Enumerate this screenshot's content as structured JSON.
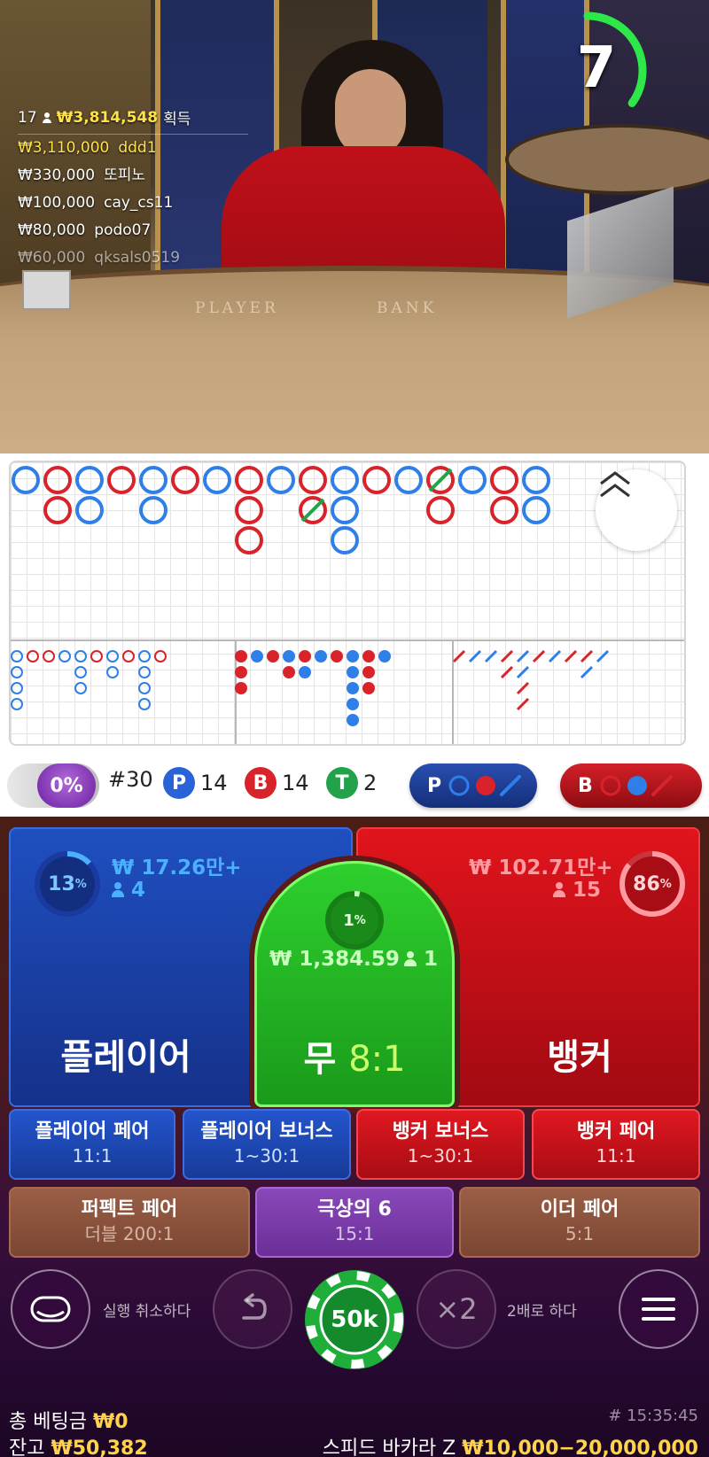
{
  "video": {
    "felt_player": "PLAYER",
    "felt_banker": "BANK",
    "winners_count": "17",
    "winners_total": "₩3,814,548",
    "winners_label": "획득",
    "winners": [
      {
        "amount": "₩3,110,000",
        "name": "ddd1"
      },
      {
        "amount": "₩330,000",
        "name": "또피노"
      },
      {
        "amount": "₩100,000",
        "name": "cay_cs11"
      },
      {
        "amount": "₩80,000",
        "name": "podo07"
      },
      {
        "amount": "₩60,000",
        "name": "qksals0519"
      }
    ],
    "timer": "7",
    "timer_fraction": 0.35,
    "timer_color": "#2ee84a"
  },
  "road": {
    "colors": {
      "player": "#2f7fe8",
      "banker": "#d8232a",
      "tie": "#22a24a"
    },
    "expand_icon": "double-chevron-up-icon"
  },
  "stats": {
    "percent": "0%",
    "round": "#30",
    "player_letter": "P",
    "player_count": "14",
    "banker_letter": "B",
    "banker_count": "14",
    "tie_letter": "T",
    "tie_count": "2",
    "predict_player": "P",
    "predict_banker": "B"
  },
  "bets": {
    "player": {
      "percent": "13",
      "amount": "₩ 17.26만+",
      "count": "4",
      "label": "플레이어",
      "fraction": 0.13
    },
    "banker": {
      "percent": "86",
      "amount": "₩ 102.71만+",
      "count": "15",
      "label": "뱅커",
      "fraction": 0.86
    },
    "tie": {
      "percent": "1",
      "amount": "₩ 1,384.59",
      "count": "1",
      "label": "무",
      "odds": "8:1",
      "fraction": 0.01
    },
    "percent_sign": "%"
  },
  "side_bets": [
    {
      "name": "플레이어 페어",
      "odds": "11:1"
    },
    {
      "name": "플레이어 보너스",
      "odds": "1~30:1"
    },
    {
      "name": "뱅커 보너스",
      "odds": "1~30:1"
    },
    {
      "name": "뱅커 페어",
      "odds": "11:1"
    },
    {
      "name": "퍼펙트 페어",
      "odds": "더블 200:1"
    },
    {
      "name": "극상의 6",
      "odds": "15:1"
    },
    {
      "name": "이더 페어",
      "odds": "5:1"
    }
  ],
  "controls": {
    "undo_label": "실행 취소하다",
    "chip_value": "50k",
    "double_text": "×2",
    "double_label": "2배로 하다"
  },
  "footer": {
    "total_bet_label": "총 베팅금",
    "total_bet": "₩0",
    "balance_label": "잔고",
    "balance": "₩50,382",
    "time": "# 15:35:45",
    "game_name": "스피드 바카라 Z",
    "limits": "₩10,000−20,000,000"
  }
}
